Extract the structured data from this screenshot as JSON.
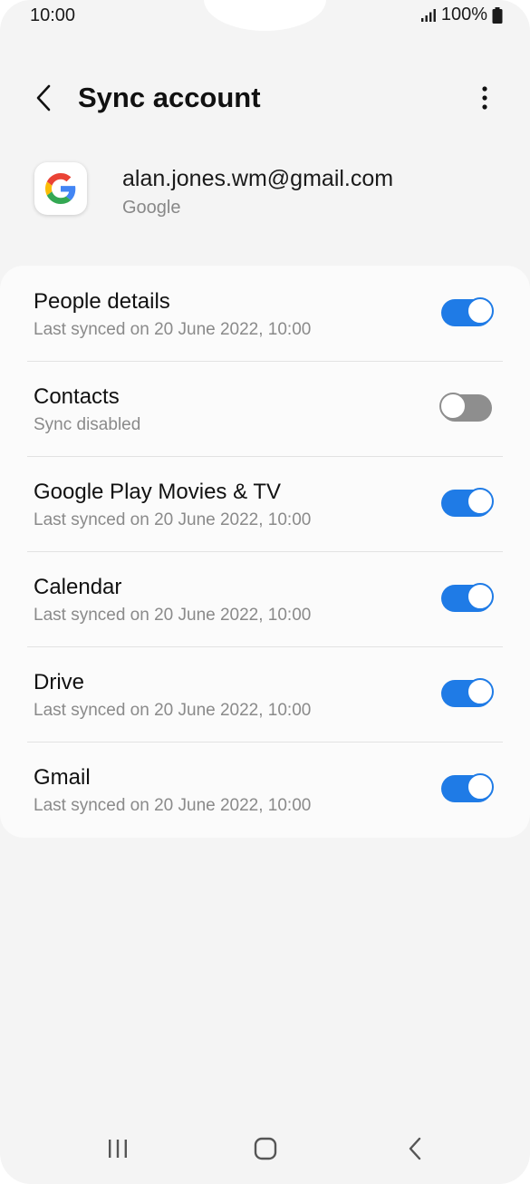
{
  "status_bar": {
    "time": "10:00",
    "battery": "100%"
  },
  "header": {
    "title": "Sync account"
  },
  "account": {
    "email": "alan.jones.wm@gmail.com",
    "type": "Google"
  },
  "sync_items": [
    {
      "title": "People details",
      "subtitle": "Last synced on 20 June 2022, 10:00",
      "enabled": true
    },
    {
      "title": "Contacts",
      "subtitle": "Sync disabled",
      "enabled": false
    },
    {
      "title": "Google Play Movies & TV",
      "subtitle": "Last synced on 20 June 2022, 10:00",
      "enabled": true
    },
    {
      "title": "Calendar",
      "subtitle": "Last synced on 20 June 2022, 10:00",
      "enabled": true
    },
    {
      "title": "Drive",
      "subtitle": "Last synced on 20 June 2022, 10:00",
      "enabled": true
    },
    {
      "title": "Gmail",
      "subtitle": "Last synced on 20 June 2022, 10:00",
      "enabled": true
    }
  ],
  "icons": {
    "back": "back-arrow-icon",
    "more": "more-vertical-icon",
    "account": "google-logo-icon",
    "nav_recents": "recents-icon",
    "nav_home": "home-icon",
    "nav_back": "nav-back-icon"
  },
  "colors": {
    "accent": "#1f7be6",
    "toggle_off": "#8e8e8e",
    "background": "#f4f4f4",
    "card": "#fbfbfb"
  }
}
